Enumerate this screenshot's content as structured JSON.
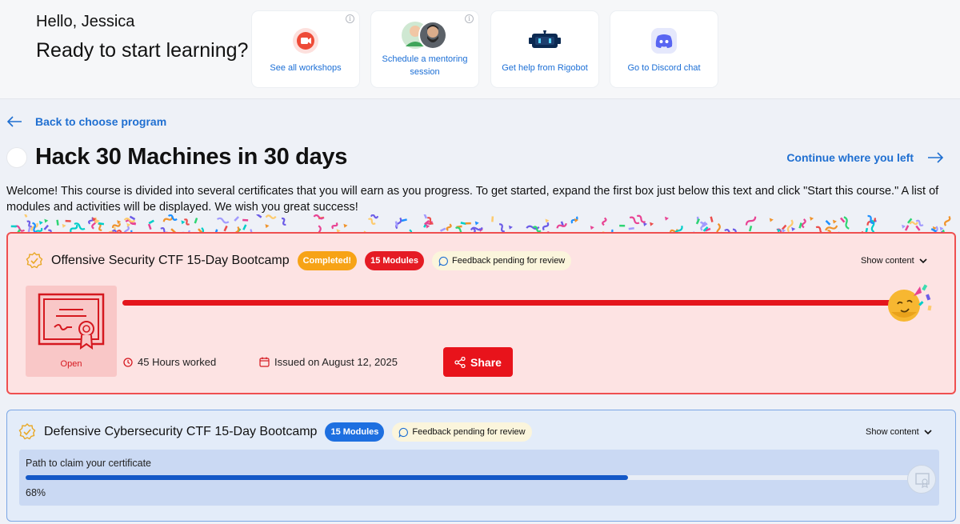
{
  "header": {
    "greeting": "Hello, Jessica",
    "subtitle": "Ready to start learning?",
    "quick_links": [
      {
        "label": "See all workshops",
        "icon": "video-icon"
      },
      {
        "label": "Schedule a mentoring session",
        "icon": "mentors-avatar"
      },
      {
        "label": "Get help from Rigobot",
        "icon": "rigobot-icon"
      },
      {
        "label": "Go to Discord chat",
        "icon": "discord-icon"
      }
    ],
    "info_glyph": "i"
  },
  "nav": {
    "back_label": "Back to choose program",
    "continue_label": "Continue where you left"
  },
  "program": {
    "title": "Hack 30 Machines in 30 days",
    "welcome": "Welcome! This course is divided into several certificates that you will earn as you progress. To get started, expand the first box just below this text and click \"Start this course.\" A list of modules and activities will be displayed. We wish you great success!"
  },
  "certificates": [
    {
      "title": "Offensive Security CTF 15-Day Bootcamp",
      "status_badge": "Completed!",
      "modules_badge": "15 Modules",
      "feedback_badge": "Feedback pending for review",
      "show_content": "Show content",
      "cert_open": "Open",
      "progress": 1.0,
      "hours": "45 Hours worked",
      "issued": "Issued on August 12, 2025",
      "share_label": "Share"
    },
    {
      "title": "Defensive Cybersecurity CTF 15-Day Bootcamp",
      "modules_badge": "15 Modules",
      "feedback_badge": "Feedback pending for review",
      "show_content": "Show content",
      "path_label": "Path to claim your certificate",
      "progress": 0.68,
      "progress_label": "68%"
    }
  ],
  "colors": {
    "accent_blue": "#1f6fd1",
    "red": "#e4151c",
    "completed_orange": "#f7a316",
    "progress_blue": "#1458c7"
  }
}
